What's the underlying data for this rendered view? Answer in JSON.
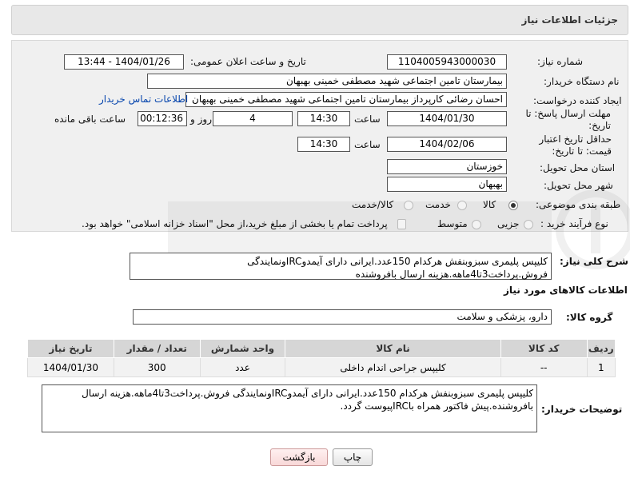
{
  "header": {
    "title": "جزئیات اطلاعات نیاز"
  },
  "fields": {
    "need_number_label": "شماره نیاز:",
    "need_number": "1104005943000030",
    "announce_label": "تاریخ و ساعت اعلان عمومی:",
    "announce_value": "1404/01/26 - 13:44",
    "buyer_org_label": "نام دستگاه خریدار:",
    "buyer_org": "بیمارستان تامین اجتماعی شهید مصطفی خمینی بهبهان",
    "creator_label": "ایجاد کننده درخواست:",
    "creator": "احسان رضائی کارپرداز بیمارستان تامین اجتماعی شهید مصطفی خمینی بهبهان",
    "contact_link": "اطلاعات تماس خریدار",
    "reply_deadline_label": "مهلت ارسال پاسخ: تا تاریخ:",
    "reply_date": "1404/01/30",
    "time_label": "ساعت",
    "reply_time": "14:30",
    "days_value": "4",
    "days_label": "روز و",
    "remaining_time": "00:12:36",
    "remaining_label": "ساعت باقی مانده",
    "price_deadline_label": "حداقل تاریخ اعتبار قیمت: تا تاریخ:",
    "price_date": "1404/02/06",
    "price_time": "14:30",
    "province_label": "استان محل تحویل:",
    "province": "خوزستان",
    "city_label": "شهر محل تحویل:",
    "city": "بهبهان",
    "category_label": "طبقه بندی موضوعی:",
    "category_options": [
      "کالا",
      "خدمت",
      "کالا/خدمت"
    ],
    "process_label": "نوع فرآیند خرید :",
    "process_options": [
      "جزیی",
      "متوسط"
    ],
    "payment_note": "پرداخت تمام یا بخشی از مبلغ خرید،از محل \"اسناد خزانه اسلامی\" خواهد بود."
  },
  "description": {
    "label": "شرح کلی نیاز:",
    "text": "کلیپس پلیمری سبزوبنفش هرکدام 150عدد.ایرانی دارای آیمدوIRCونمایندگی فروش.پرداخت3تا4ماهه.هزینه ارسال بافروشنده"
  },
  "goods": {
    "section_title": "اطلاعات کالاهای مورد نیاز",
    "group_label": "گروه کالا:",
    "group_value": "دارو، پزشکی و سلامت",
    "columns": [
      "ردیف",
      "کد کالا",
      "نام کالا",
      "واحد شمارش",
      "تعداد / مقدار",
      "تاریخ نیاز"
    ],
    "rows": [
      [
        "1",
        "--",
        "کلیپس جراحی اندام داخلی",
        "عدد",
        "300",
        "1404/01/30"
      ]
    ]
  },
  "buyer_notes": {
    "label": "توضیحات خریدار:",
    "text": "کلیپس پلیمری سبزوبنفش هرکدام 150عدد.ایرانی دارای آیمدوIRCونمایندگی فروش.پرداخت3تا4ماهه.هزینه ارسال بافروشنده.پیش فاکتور همراه باIRCپیوست گردد."
  },
  "buttons": {
    "print": "چاپ",
    "back": "بازگشت"
  }
}
